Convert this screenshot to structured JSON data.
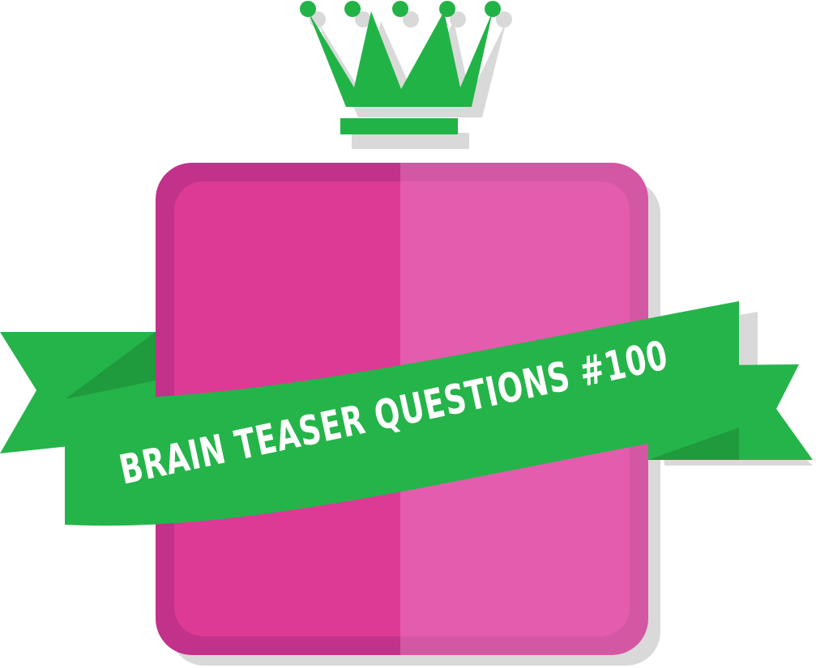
{
  "banner": {
    "title": "BRAIN TEASER QUESTIONS #100"
  },
  "icons": {
    "crown": "crown-icon"
  },
  "colors": {
    "crown_green": "#22b347",
    "ribbon_green": "#25b449",
    "ribbon_dark_green": "#1f9a3d",
    "box_pink_left": "#dd3a96",
    "box_pink_right": "#e45cae",
    "box_border_left": "#c2318a",
    "box_border_right": "#d457a3",
    "shadow_gray": "#d9d9d9",
    "text_white": "#ffffff"
  }
}
